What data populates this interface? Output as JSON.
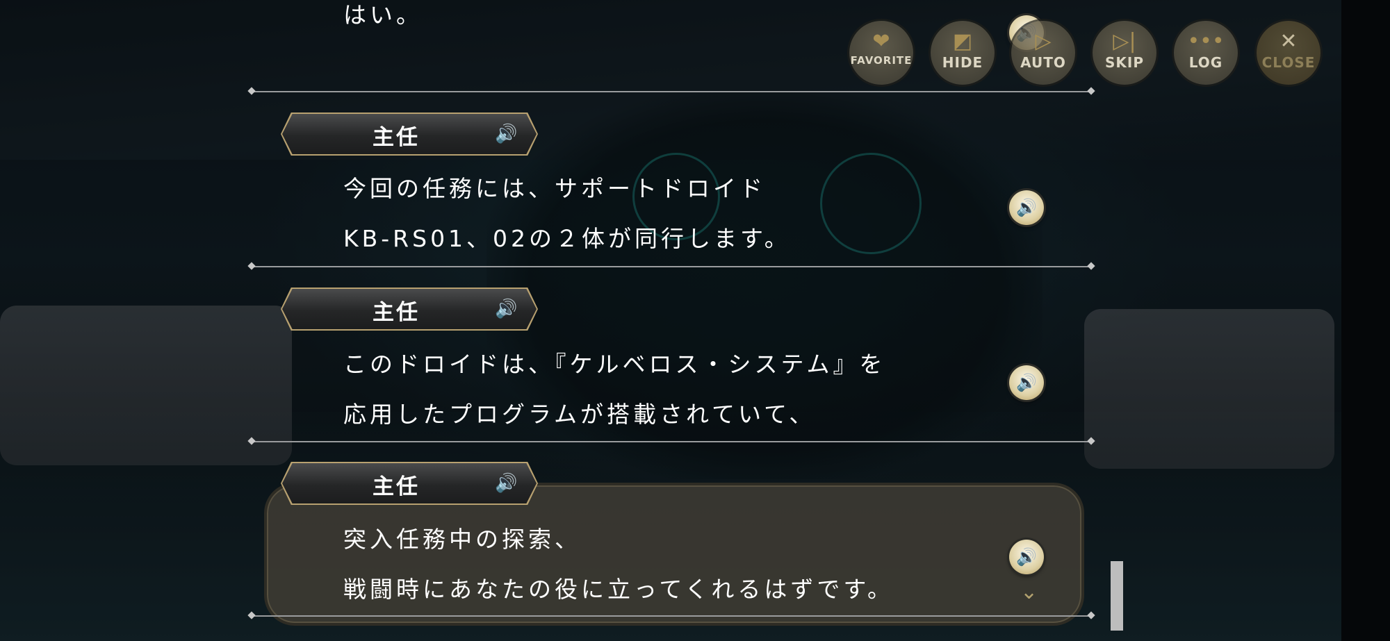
{
  "toolbar": {
    "favorite_label": "FAVORITE",
    "hide_label": "HIDE",
    "auto_label": "AUTO",
    "skip_label": "SKIP",
    "log_label": "LOG",
    "close_label": "CLOSE"
  },
  "log": {
    "entries": [
      {
        "speaker": "",
        "lines": [
          "はい。"
        ]
      },
      {
        "speaker": "主任",
        "lines": [
          "今回の任務には、サポートドロイド",
          "KB-RS01、02の２体が同行します。"
        ]
      },
      {
        "speaker": "主任",
        "lines": [
          "このドロイドは、『ケルベロス・システム』を",
          "応用したプログラムが搭載されていて、"
        ]
      },
      {
        "speaker": "主任",
        "lines": [
          "突入任務中の探索、",
          "戦闘時にあなたの役に立ってくれるはずです。"
        ]
      }
    ]
  },
  "icons": {
    "voice": "speaker-icon",
    "favorite": "heart-icon",
    "hide": "eye-slash-icon",
    "auto": "auto-play-icon",
    "skip": "skip-icon",
    "log": "chat-log-icon",
    "close": "close-icon"
  },
  "colors": {
    "accent_gold": "#b8a170",
    "text": "#ffffff"
  }
}
